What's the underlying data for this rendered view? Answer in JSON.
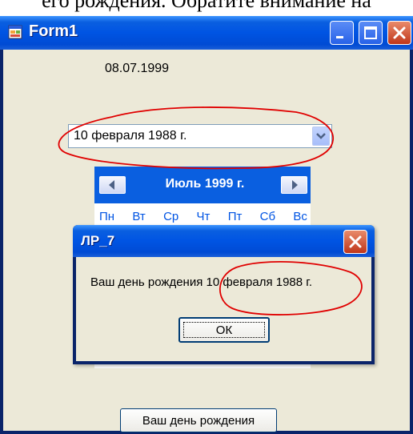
{
  "document": {
    "caption": "его рождения. Обратите внимание на"
  },
  "window": {
    "title": "Form1",
    "icons": {
      "app": "form-app-icon",
      "minimize": "minimize-icon",
      "maximize": "maximize-icon",
      "close": "close-icon"
    }
  },
  "form": {
    "date_label": "08.07.1999",
    "picker": {
      "value": "10 февраля 1988 г.",
      "dropdown_icon": "chevron-down-icon"
    },
    "calendar": {
      "month_title": "Июль 1999 г.",
      "day_names": [
        "Пн",
        "Вт",
        "Ср",
        "Чт",
        "Пт",
        "Сб",
        "Вс"
      ],
      "prev_icon": "arrow-left-icon",
      "next_icon": "arrow-right-icon"
    },
    "birthday_button": "Ваш день рождения"
  },
  "dialog": {
    "title": "ЛР_7",
    "message": "Ваш день рождения 10 февраля 1988 г.",
    "ok_label": "ОК",
    "close_icon": "close-icon"
  },
  "colors": {
    "titlebar_blue": "#0054e3",
    "close_red": "#c0361b",
    "window_bg": "#ece9d8",
    "annotation_red": "#e00000"
  }
}
